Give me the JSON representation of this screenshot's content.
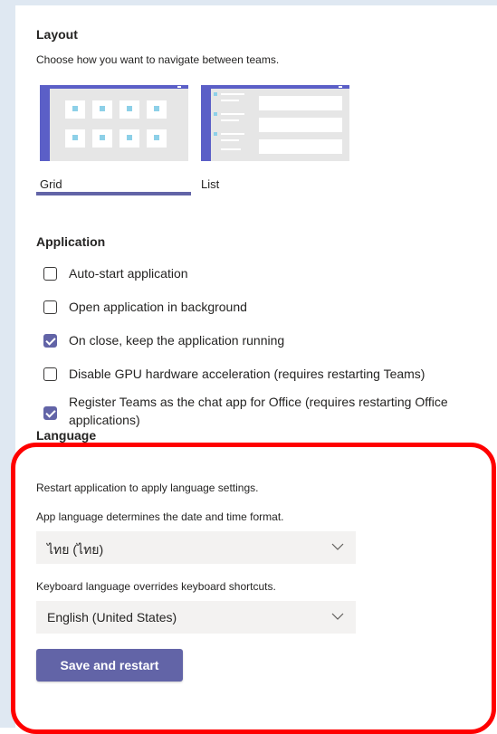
{
  "layout": {
    "heading": "Layout",
    "description": "Choose how you want to navigate between teams.",
    "options": [
      {
        "label": "Grid",
        "selected": true
      },
      {
        "label": "List",
        "selected": false
      }
    ]
  },
  "application": {
    "heading": "Application",
    "options": [
      {
        "label": "Auto-start application",
        "checked": false
      },
      {
        "label": "Open application in background",
        "checked": false
      },
      {
        "label": "On close, keep the application running",
        "checked": true
      },
      {
        "label": "Disable GPU hardware acceleration (requires restarting Teams)",
        "checked": false
      },
      {
        "label": "Register Teams as the chat app for Office (requires restarting Office applications)",
        "checked": true
      }
    ]
  },
  "language": {
    "heading": "Language",
    "restart_note": "Restart application to apply language settings.",
    "app_language_label": "App language determines the date and time format.",
    "app_language_value": "ไทย (ไทย)",
    "keyboard_language_label": "Keyboard language overrides keyboard shortcuts.",
    "keyboard_language_value": "English (United States)",
    "save_button": "Save and restart"
  },
  "colors": {
    "accent": "#6264a7",
    "highlight_ring": "#ff0000"
  }
}
